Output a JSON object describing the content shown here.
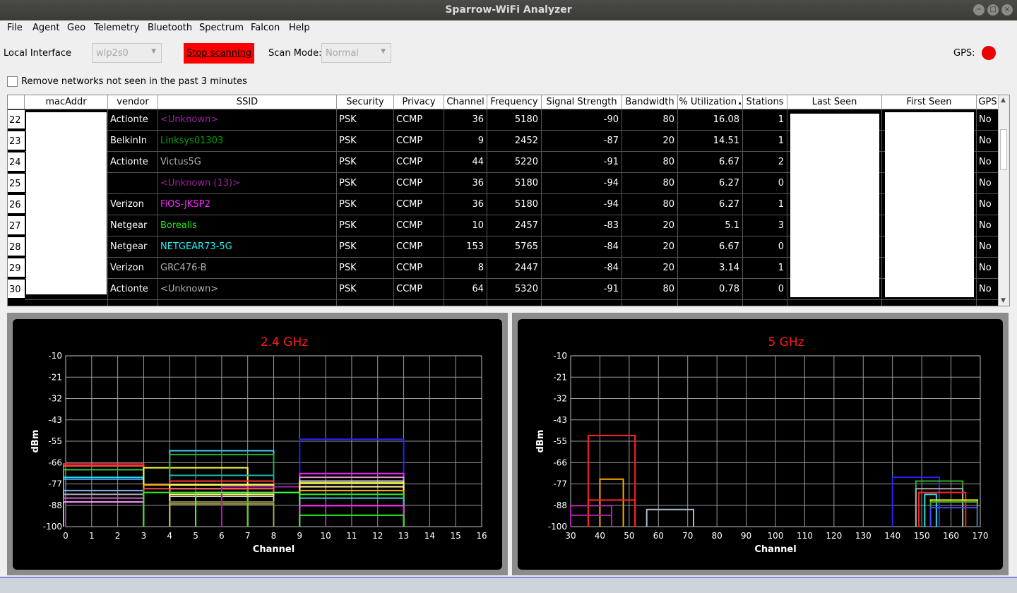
{
  "window": {
    "title": "Sparrow-WiFi Analyzer"
  },
  "menu": [
    "File",
    "Agent",
    "Geo",
    "Telemetry",
    "Bluetooth",
    "Spectrum",
    "Falcon",
    "Help"
  ],
  "toolbar": {
    "local_interface_label": "Local Interface",
    "interface_value": "wlp2s0",
    "stop_label": "Stop scanning",
    "scan_mode_label": "Scan Mode:",
    "scan_mode_value": "Normal",
    "gps_label": "GPS:",
    "gps_status_color": "#ee0000"
  },
  "filter": {
    "remove_label": "Remove networks not seen in the past 3 minutes",
    "checked": false
  },
  "table": {
    "headers": [
      "macAddr",
      "vendor",
      "SSID",
      "Security",
      "Privacy",
      "Channel",
      "Frequency",
      "Signal Strength",
      "Bandwidth",
      "% Utilization",
      "Stations",
      "Last Seen",
      "First Seen",
      "GPS"
    ],
    "rows": [
      {
        "n": "22",
        "vendor": "Actionte",
        "ssid": "<Unknown>",
        "ssid_color": "#a020a0",
        "security": "PSK",
        "privacy": "CCMP",
        "channel": "36",
        "frequency": "5180",
        "signal": "-90",
        "bandwidth": "80",
        "util": "16.08",
        "stations": "1",
        "gps": "No"
      },
      {
        "n": "23",
        "vendor": "BelkinIn",
        "ssid": "Linksys01303",
        "ssid_color": "#0aa00a",
        "security": "PSK",
        "privacy": "CCMP",
        "channel": "9",
        "frequency": "2452",
        "signal": "-87",
        "bandwidth": "20",
        "util": "14.51",
        "stations": "1",
        "gps": "No"
      },
      {
        "n": "24",
        "vendor": "Actionte",
        "ssid": "Victus5G",
        "ssid_color": "#b0b0b0",
        "security": "PSK",
        "privacy": "CCMP",
        "channel": "44",
        "frequency": "5220",
        "signal": "-91",
        "bandwidth": "80",
        "util": "6.67",
        "stations": "2",
        "gps": "No"
      },
      {
        "n": "25",
        "vendor": "",
        "ssid": "<Unknown (13)>",
        "ssid_color": "#a020a0",
        "security": "PSK",
        "privacy": "CCMP",
        "channel": "36",
        "frequency": "5180",
        "signal": "-94",
        "bandwidth": "80",
        "util": "6.27",
        "stations": "0",
        "gps": "No"
      },
      {
        "n": "26",
        "vendor": "Verizon",
        "ssid": "FiOS-JKSP2",
        "ssid_color": "#ff22ff",
        "security": "PSK",
        "privacy": "CCMP",
        "channel": "36",
        "frequency": "5180",
        "signal": "-94",
        "bandwidth": "80",
        "util": "6.27",
        "stations": "1",
        "gps": "No"
      },
      {
        "n": "27",
        "vendor": "Netgear",
        "ssid": "Borealis",
        "ssid_color": "#22ee22",
        "security": "PSK",
        "privacy": "CCMP",
        "channel": "10",
        "frequency": "2457",
        "signal": "-83",
        "bandwidth": "20",
        "util": "5.1",
        "stations": "3",
        "gps": "No"
      },
      {
        "n": "28",
        "vendor": "Netgear",
        "ssid": "NETGEAR73-5G",
        "ssid_color": "#22eeee",
        "security": "PSK",
        "privacy": "CCMP",
        "channel": "153",
        "frequency": "5765",
        "signal": "-84",
        "bandwidth": "20",
        "util": "6.67",
        "stations": "0",
        "gps": "No"
      },
      {
        "n": "29",
        "vendor": "Verizon",
        "ssid": "GRC476-B",
        "ssid_color": "#b0b0b0",
        "security": "PSK",
        "privacy": "CCMP",
        "channel": "8",
        "frequency": "2447",
        "signal": "-84",
        "bandwidth": "20",
        "util": "3.14",
        "stations": "1",
        "gps": "No"
      },
      {
        "n": "30",
        "vendor": "Actionte",
        "ssid": "<Unknown>",
        "ssid_color": "#b0b0b0",
        "security": "PSK",
        "privacy": "CCMP",
        "channel": "64",
        "frequency": "5320",
        "signal": "-91",
        "bandwidth": "80",
        "util": "0.78",
        "stations": "0",
        "gps": "No"
      }
    ]
  },
  "chart_data": [
    {
      "type": "line",
      "title": "2.4 GHz",
      "xlabel": "Channel",
      "ylabel": "dBm",
      "xlim": [
        0,
        16
      ],
      "ylim": [
        -100,
        -10
      ],
      "xticks": [
        "0",
        "1",
        "2",
        "3",
        "4",
        "5",
        "6",
        "7",
        "8",
        "9",
        "10",
        "11",
        "12",
        "13",
        "14",
        "15",
        "16"
      ],
      "yticks": [
        "-10",
        "-21",
        "-32",
        "-43",
        "-55",
        "-66",
        "-77",
        "-88",
        "-100"
      ],
      "grid": true,
      "series": [
        {
          "x": [
            -1,
            3
          ],
          "y": -67,
          "color": "#ff3333"
        },
        {
          "x": [
            -1,
            3
          ],
          "y": -68,
          "color": "#ff4444"
        },
        {
          "x": [
            -1,
            3
          ],
          "y": -70,
          "color": "#33cc33"
        },
        {
          "x": [
            -1,
            3
          ],
          "y": -74,
          "color": "#22dddd"
        },
        {
          "x": [
            -1,
            3
          ],
          "y": -75,
          "color": "#44aaff"
        },
        {
          "x": [
            -1,
            3
          ],
          "y": -81,
          "color": "#88aaff"
        },
        {
          "x": [
            -1,
            3
          ],
          "y": -83,
          "color": "#aaaaaa"
        },
        {
          "x": [
            -1,
            3
          ],
          "y": -85,
          "color": "#cc66cc"
        },
        {
          "x": [
            -1,
            3
          ],
          "y": -87,
          "color": "#ff88ff"
        },
        {
          "x": [
            3,
            7
          ],
          "y": -69,
          "color": "#ffff33"
        },
        {
          "x": [
            3,
            7
          ],
          "y": -78,
          "color": "#ffaa00"
        },
        {
          "x": [
            3,
            7
          ],
          "y": -80,
          "color": "#ff4444"
        },
        {
          "x": [
            3,
            7
          ],
          "y": -82,
          "color": "#22ee22"
        },
        {
          "x": [
            4,
            8
          ],
          "y": -60,
          "color": "#44ccff"
        },
        {
          "x": [
            4,
            8
          ],
          "y": -62,
          "color": "#33aa33"
        },
        {
          "x": [
            4,
            8
          ],
          "y": -73,
          "color": "#22aaaa"
        },
        {
          "x": [
            4,
            8
          ],
          "y": -76,
          "color": "#ff3333"
        },
        {
          "x": [
            4,
            8
          ],
          "y": -78,
          "color": "#ffff44"
        },
        {
          "x": [
            4,
            8
          ],
          "y": -80,
          "color": "#ff6666"
        },
        {
          "x": [
            4,
            8
          ],
          "y": -83,
          "color": "#ffee55"
        },
        {
          "x": [
            4,
            8
          ],
          "y": -84,
          "color": "#cccccc"
        },
        {
          "x": [
            4,
            8
          ],
          "y": -87,
          "color": "#888844"
        },
        {
          "x": [
            4,
            8
          ],
          "y": -88,
          "color": "#aaaa55"
        },
        {
          "x": [
            6,
            10
          ],
          "y": -79,
          "color": "#aa22aa"
        },
        {
          "x": [
            5,
            9
          ],
          "y": -82,
          "color": "#44ff44"
        },
        {
          "x": [
            9,
            13
          ],
          "y": -54,
          "color": "#2222ff"
        },
        {
          "x": [
            9,
            13
          ],
          "y": -72,
          "color": "#ff22ff"
        },
        {
          "x": [
            9,
            13
          ],
          "y": -74,
          "color": "#dd99dd"
        },
        {
          "x": [
            9,
            13
          ],
          "y": -76,
          "color": "#dddddd"
        },
        {
          "x": [
            9,
            13
          ],
          "y": -77,
          "color": "#ffff33"
        },
        {
          "x": [
            9,
            13
          ],
          "y": -79,
          "color": "#ffffaa"
        },
        {
          "x": [
            9,
            13
          ],
          "y": -81,
          "color": "#ffaa00"
        },
        {
          "x": [
            9,
            13
          ],
          "y": -83,
          "color": "#22ee22"
        },
        {
          "x": [
            9,
            13
          ],
          "y": -85,
          "color": "#33cccc"
        },
        {
          "x": [
            9,
            13
          ],
          "y": -89,
          "color": "#ff22ff"
        },
        {
          "x": [
            9,
            13
          ],
          "y": -94,
          "color": "#22ee22"
        }
      ]
    },
    {
      "type": "line",
      "title": "5 GHz",
      "xlabel": "Channel",
      "ylabel": "dBm",
      "xlim": [
        30,
        170
      ],
      "ylim": [
        -100,
        -10
      ],
      "xticks": [
        "30",
        "40",
        "50",
        "60",
        "70",
        "80",
        "90",
        "100",
        "110",
        "120",
        "130",
        "140",
        "150",
        "160",
        "170"
      ],
      "yticks": [
        "-10",
        "-21",
        "-32",
        "-43",
        "-55",
        "-66",
        "-77",
        "-88",
        "-100"
      ],
      "grid": true,
      "series": [
        {
          "x": [
            36,
            52
          ],
          "y": -52,
          "color": "#ff2222"
        },
        {
          "x": [
            40,
            48
          ],
          "y": -75,
          "color": "#ffaa00"
        },
        {
          "x": [
            36,
            52
          ],
          "y": -86,
          "color": "#ff2222"
        },
        {
          "x": [
            30,
            44
          ],
          "y": -89,
          "color": "#aa22aa"
        },
        {
          "x": [
            30,
            44
          ],
          "y": -94,
          "color": "#aa22aa"
        },
        {
          "x": [
            56,
            72
          ],
          "y": -91,
          "color": "#aabbcc"
        },
        {
          "x": [
            140,
            156
          ],
          "y": -74,
          "color": "#2222ff"
        },
        {
          "x": [
            148,
            164
          ],
          "y": -76,
          "color": "#33aa33"
        },
        {
          "x": [
            148,
            164
          ],
          "y": -80,
          "color": "#aaaaaa"
        },
        {
          "x": [
            149,
            165
          ],
          "y": -82,
          "color": "#ff2222"
        },
        {
          "x": [
            151,
            155
          ],
          "y": -83,
          "color": "#22dddd"
        },
        {
          "x": [
            153,
            169
          ],
          "y": -86,
          "color": "#ffee00"
        },
        {
          "x": [
            153,
            169
          ],
          "y": -87,
          "color": "#33aa33"
        },
        {
          "x": [
            153,
            169
          ],
          "y": -90,
          "color": "#4444ff"
        }
      ]
    }
  ]
}
